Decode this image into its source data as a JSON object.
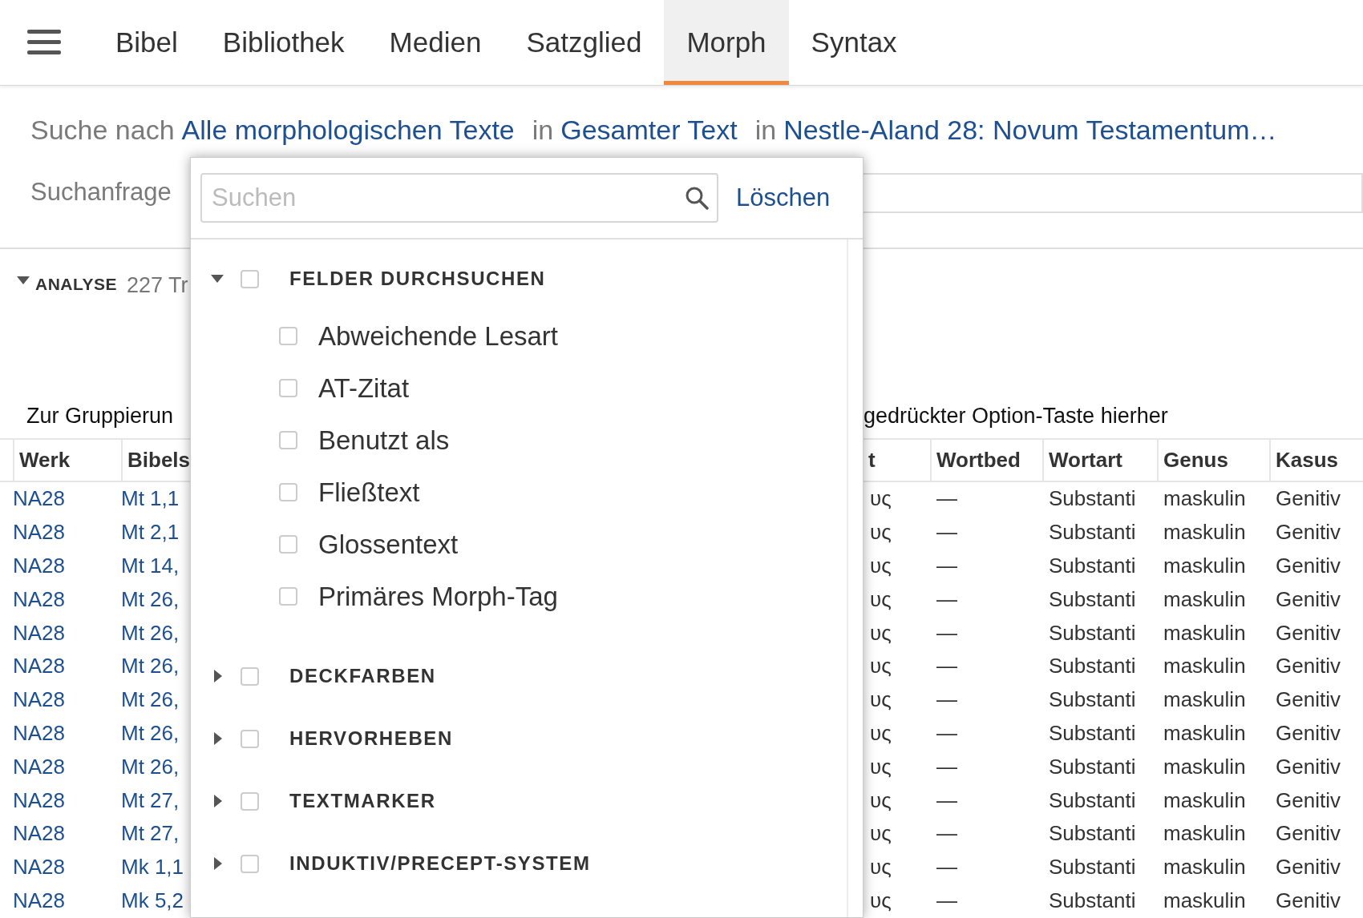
{
  "nav": {
    "items": [
      {
        "label": "Bibel",
        "selected": false
      },
      {
        "label": "Bibliothek",
        "selected": false
      },
      {
        "label": "Medien",
        "selected": false
      },
      {
        "label": "Satzglied",
        "selected": false
      },
      {
        "label": "Morph",
        "selected": true
      },
      {
        "label": "Syntax",
        "selected": false
      }
    ]
  },
  "search_line": {
    "prefix": "Suche nach",
    "scope": "Alle morphologischen Texte",
    "in_1": "in",
    "range": "Gesamter Text",
    "in_2": "in",
    "resource": "Nestle-Aland 28: Novum Testamentum…"
  },
  "query_label": "Suchanfrage",
  "analysis": {
    "label": "ANALYSE",
    "expanded": true,
    "count": "227 Tr"
  },
  "group_hint_left": "Zur Gruppierun",
  "group_hint_right": "gedrückter Option-Taste hierher",
  "table": {
    "columns_left": [
      "Werk",
      "Bibels"
    ],
    "columns_right": [
      "t",
      "Wortbed",
      "Wortart",
      "Genus",
      "Kasus"
    ],
    "rows": [
      {
        "left": [
          "NA28",
          "Mt 1,1"
        ],
        "right": [
          "υς",
          "—",
          "Substanti",
          "maskulin",
          "Genitiv"
        ]
      },
      {
        "left": [
          "NA28",
          "Mt 2,1"
        ],
        "right": [
          "υς",
          "—",
          "Substanti",
          "maskulin",
          "Genitiv"
        ]
      },
      {
        "left": [
          "NA28",
          "Mt 14,"
        ],
        "right": [
          "υς",
          "—",
          "Substanti",
          "maskulin",
          "Genitiv"
        ]
      },
      {
        "left": [
          "NA28",
          "Mt 26,"
        ],
        "right": [
          "υς",
          "—",
          "Substanti",
          "maskulin",
          "Genitiv"
        ]
      },
      {
        "left": [
          "NA28",
          "Mt 26,"
        ],
        "right": [
          "υς",
          "—",
          "Substanti",
          "maskulin",
          "Genitiv"
        ]
      },
      {
        "left": [
          "NA28",
          "Mt 26,"
        ],
        "right": [
          "υς",
          "—",
          "Substanti",
          "maskulin",
          "Genitiv"
        ]
      },
      {
        "left": [
          "NA28",
          "Mt 26,"
        ],
        "right": [
          "υς",
          "—",
          "Substanti",
          "maskulin",
          "Genitiv"
        ]
      },
      {
        "left": [
          "NA28",
          "Mt 26,"
        ],
        "right": [
          "υς",
          "—",
          "Substanti",
          "maskulin",
          "Genitiv"
        ]
      },
      {
        "left": [
          "NA28",
          "Mt 26,"
        ],
        "right": [
          "υς",
          "—",
          "Substanti",
          "maskulin",
          "Genitiv"
        ]
      },
      {
        "left": [
          "NA28",
          "Mt 27,"
        ],
        "right": [
          "υς",
          "—",
          "Substanti",
          "maskulin",
          "Genitiv"
        ]
      },
      {
        "left": [
          "NA28",
          "Mt 27,"
        ],
        "right": [
          "υς",
          "—",
          "Substanti",
          "maskulin",
          "Genitiv"
        ]
      },
      {
        "left": [
          "NA28",
          "Mk 1,1"
        ],
        "right": [
          "υς",
          "—",
          "Substanti",
          "maskulin",
          "Genitiv"
        ]
      },
      {
        "left": [
          "NA28",
          "Mk 5,2"
        ],
        "right": [
          "υς",
          "—",
          "Substanti",
          "maskulin",
          "Genitiv"
        ]
      }
    ]
  },
  "popup": {
    "search": {
      "placeholder": "Suchen"
    },
    "clear": "Löschen",
    "groups": [
      {
        "label": "FELDER DURCHSUCHEN",
        "expanded": true,
        "checked": false,
        "children": [
          {
            "label": "Abweichende Lesart",
            "checked": false
          },
          {
            "label": "AT-Zitat",
            "checked": false
          },
          {
            "label": "Benutzt als",
            "checked": false
          },
          {
            "label": "Fließtext",
            "checked": false
          },
          {
            "label": "Glossentext",
            "checked": false
          },
          {
            "label": "Primäres Morph-Tag",
            "checked": false
          }
        ]
      },
      {
        "label": "DECKFARBEN",
        "expanded": false,
        "checked": false
      },
      {
        "label": "HERVORHEBEN",
        "expanded": false,
        "checked": false
      },
      {
        "label": "TEXTMARKER",
        "expanded": false,
        "checked": false
      },
      {
        "label": "INDUKTIV/PRECEPT-SYSTEM",
        "expanded": false,
        "checked": false
      }
    ]
  }
}
